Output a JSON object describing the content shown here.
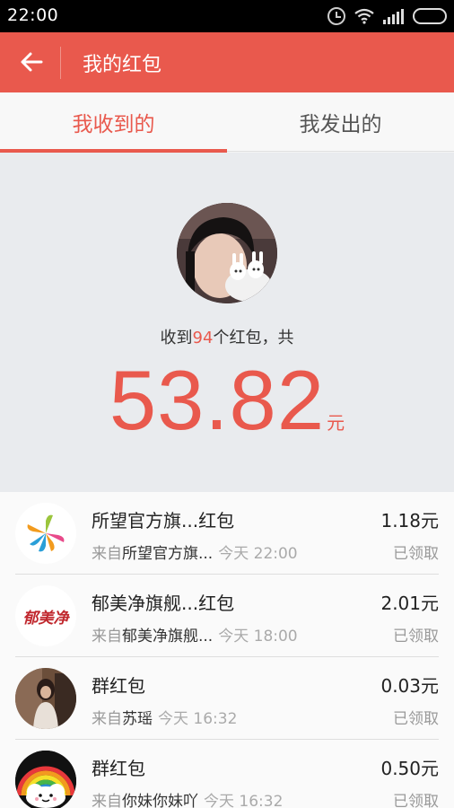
{
  "status_bar": {
    "time": "22:00"
  },
  "header": {
    "title": "我的红包"
  },
  "tabs": [
    {
      "label": "我收到的",
      "active": true
    },
    {
      "label": "我发出的",
      "active": false
    }
  ],
  "summary": {
    "prefix": "收到",
    "count": "94",
    "suffix": "个红包，共",
    "total_amount": "53.82",
    "currency_unit": "元"
  },
  "list": {
    "from_label": "来自",
    "items": [
      {
        "name": "所望官方旗...红包",
        "sender": "所望官方旗...",
        "time": "今天 22:00",
        "amount": "1.18元",
        "status": "已领取"
      },
      {
        "name": "郁美净旗舰...红包",
        "sender": "郁美净旗舰...",
        "time": "今天 18:00",
        "amount": "2.01元",
        "status": "已领取",
        "logo_text": "郁美净"
      },
      {
        "name": "群红包",
        "sender": "苏瑶",
        "time": "今天 16:32",
        "amount": "0.03元",
        "status": "已领取"
      },
      {
        "name": "群红包",
        "sender": "你妹你妹吖",
        "time": "今天 16:32",
        "amount": "0.50元",
        "status": "已领取"
      }
    ]
  },
  "colors": {
    "accent": "#e9594d",
    "background": "#e9ebee"
  }
}
